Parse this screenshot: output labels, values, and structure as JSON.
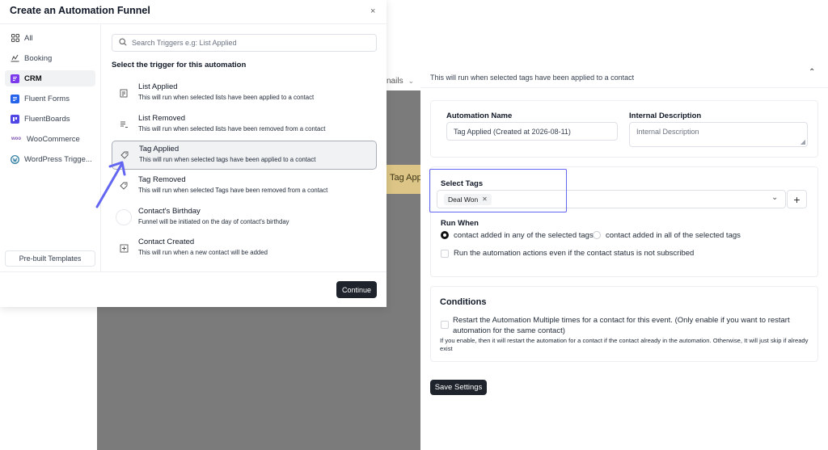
{
  "modal": {
    "title": "Create an Automation Funnel",
    "close_glyph": "×",
    "categories": [
      {
        "label": "All",
        "icon": "grid-icon"
      },
      {
        "label": "Booking",
        "icon": "booking-icon"
      },
      {
        "label": "CRM",
        "icon": "crm-icon",
        "active": true
      },
      {
        "label": "Fluent Forms",
        "icon": "fluent-forms-icon"
      },
      {
        "label": "FluentBoards",
        "icon": "fluentboards-icon"
      },
      {
        "label": "WooCommerce",
        "icon": "woocommerce-icon"
      },
      {
        "label": "WordPress Trigge...",
        "icon": "wordpress-icon"
      }
    ],
    "prebuilt_label": "Pre-built Templates",
    "search_placeholder": "Search Triggers e.g: List Applied",
    "trigger_heading": "Select the trigger for this automation",
    "triggers": [
      {
        "title": "List Applied",
        "desc": "This will run when selected lists have been applied to a contact",
        "icon": "list-add-icon"
      },
      {
        "title": "List Removed",
        "desc": "This will run when selected lists have been removed from a contact",
        "icon": "list-remove-icon"
      },
      {
        "title": "Tag Applied",
        "desc": "This will run when selected tags have been applied to a contact",
        "icon": "tag-add-icon",
        "selected": true
      },
      {
        "title": "Tag Removed",
        "desc": "This will run when selected Tags have been removed from a contact",
        "icon": "tag-remove-icon"
      },
      {
        "title": "Contact's Birthday",
        "desc": "Funnel will be initiated on the day of contact's birthday",
        "icon": "birthday-icon"
      },
      {
        "title": "Contact Created",
        "desc": "This will run when a new contact will be added",
        "icon": "contact-add-icon"
      }
    ],
    "continue_label": "Continue"
  },
  "background": {
    "emails_label": "nails",
    "tag_pill_label": "Tag App"
  },
  "settings": {
    "description": "This will run when selected tags have been applied to a contact",
    "automation_name_label": "Automation Name",
    "automation_name_value": "Tag Applied (Created at 2026-08-11)",
    "internal_description_label": "Internal Description",
    "internal_description_placeholder": "Internal Description",
    "select_tags_label": "Select Tags",
    "selected_tag": "Deal Won",
    "add_glyph": "+",
    "run_when_label": "Run When",
    "run_when_options": [
      {
        "label": "contact added in any of the selected tags",
        "checked": true
      },
      {
        "label": "contact added in all of the selected tags",
        "checked": false
      }
    ],
    "run_unsubscribed_label": "Run the automation actions even if the contact status is not subscribed",
    "conditions_title": "Conditions",
    "restart_label": "Restart the Automation Multiple times for a contact for this event. (Only enable if you want to restart automation for the same contact)",
    "restart_help": "If you enable, then it will restart the automation for a contact if the contact already in the automation. Otherwise, It will just skip if already exist",
    "save_label": "Save Settings"
  },
  "colors": {
    "primary_dark": "#1f232b",
    "highlight": "#6366f1",
    "annotation_arrow": "#6366f1",
    "crm_purple": "#7c3aed",
    "fluent_blue": "#2563eb",
    "woo_purple": "#7f54b3"
  }
}
